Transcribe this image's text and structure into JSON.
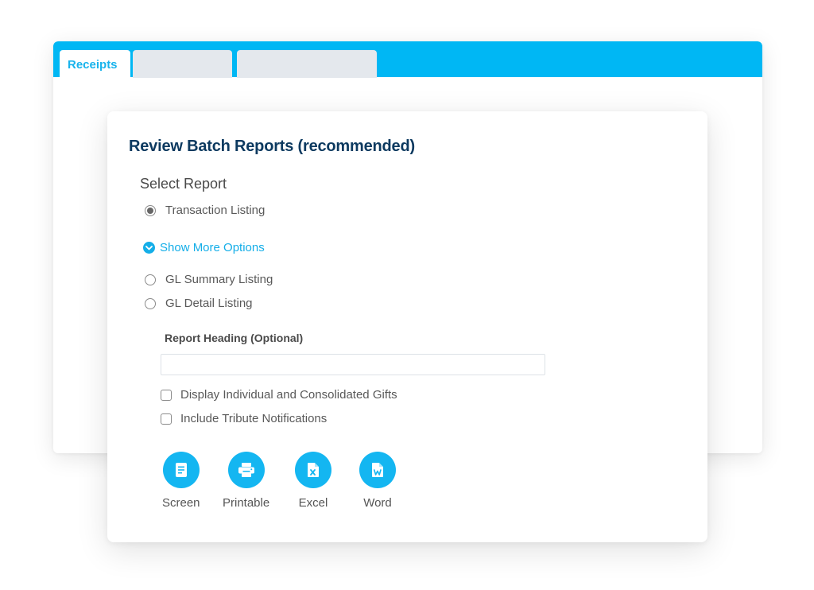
{
  "colors": {
    "accent": "#00b7f4",
    "title": "#0d3a60",
    "link": "#14aee8",
    "tab_inactive": "#e4e8ed"
  },
  "window": {
    "tabs": [
      {
        "label": "Receipts",
        "active": true
      },
      {
        "label": "",
        "active": false
      },
      {
        "label": "",
        "active": false
      }
    ]
  },
  "dialog": {
    "title": "Review Batch Reports (recommended)",
    "select_report_label": "Select Report",
    "reports": [
      {
        "label": "Transaction Listing",
        "selected": true
      },
      {
        "label": "GL Summary Listing",
        "selected": false
      },
      {
        "label": "GL Detail Listing",
        "selected": false
      }
    ],
    "show_more": {
      "label": "Show More Options",
      "icon": "chevron-down-circle-icon"
    },
    "report_heading": {
      "label": "Report Heading (Optional)",
      "value": "",
      "placeholder": ""
    },
    "options": [
      {
        "label": "Display Individual and Consolidated Gifts",
        "checked": false
      },
      {
        "label": "Include Tribute Notifications",
        "checked": false
      }
    ],
    "output_buttons": [
      {
        "label": "Screen",
        "icon": "document-icon"
      },
      {
        "label": "Printable",
        "icon": "printer-icon"
      },
      {
        "label": "Excel",
        "icon": "excel-file-icon"
      },
      {
        "label": "Word",
        "icon": "word-file-icon"
      }
    ]
  }
}
